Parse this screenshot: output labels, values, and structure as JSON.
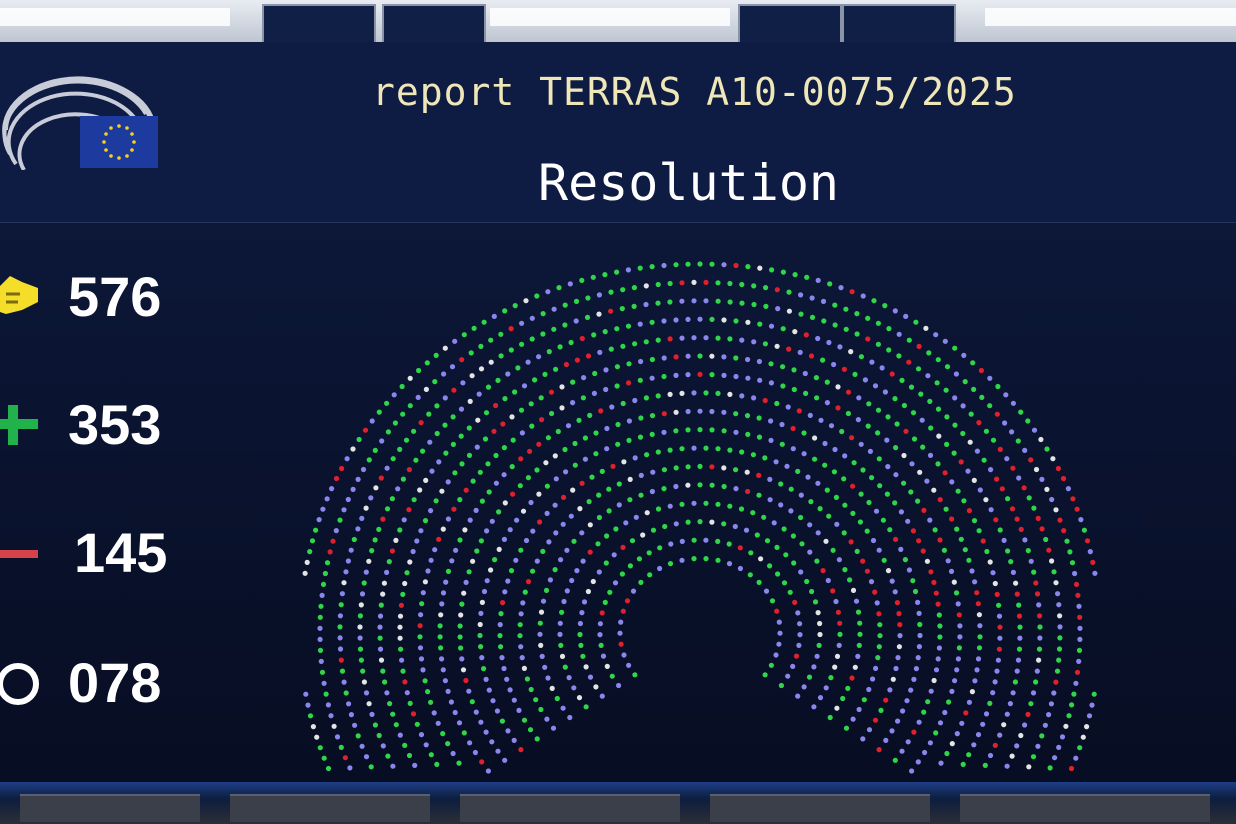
{
  "header": {
    "report_line": "report TERRAS A10-0075/2025",
    "title": "Resolution"
  },
  "results": [
    {
      "name": "voters",
      "value": "576",
      "icon": "hand-vote-icon",
      "color": "#f4de2a"
    },
    {
      "name": "for",
      "value": "353",
      "icon": "plus-icon",
      "color": "#22b24c"
    },
    {
      "name": "against",
      "value": "145",
      "icon": "minus-icon",
      "color": "#d4424a"
    },
    {
      "name": "abstention",
      "value": "078",
      "icon": "circle-icon",
      "color": "#ffffff"
    }
  ],
  "colors": {
    "seat_for": "#2fd64a",
    "seat_against": "#e0202c",
    "seat_abstain": "#e4e4e4",
    "seat_absent": "#8a86ee",
    "eu_flag_blue": "#1d3a9e",
    "eu_flag_stars": "#f6d31a"
  }
}
